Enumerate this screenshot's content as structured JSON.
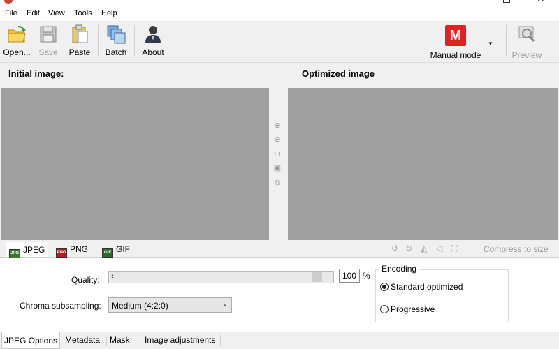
{
  "menu": [
    "File",
    "Edit",
    "View",
    "Tools",
    "Help"
  ],
  "toolbar": {
    "open": "Open...",
    "save": "Save",
    "paste": "Paste",
    "batch": "Batch",
    "about": "About",
    "mode_badge": "M",
    "mode": "Manual mode",
    "preview": "Preview"
  },
  "panels": {
    "initial": "Initial image:",
    "optimized": "Optimized image",
    "zoom_ratio": "1:1"
  },
  "format_tabs": [
    {
      "label": "JPEG",
      "icon": "JPG"
    },
    {
      "label": "PNG",
      "icon": "PNG"
    },
    {
      "label": "GIF",
      "icon": "GIF"
    }
  ],
  "compress_to_size": "Compress to size",
  "jpeg_options": {
    "quality_label": "Quality:",
    "quality_value": "100",
    "quality_unit": "%",
    "chroma_label": "Chroma subsampling:",
    "chroma_value": "Medium (4:2:0)",
    "encoding_title": "Encoding",
    "encoding_options": [
      "Standard optimized",
      "Progressive"
    ],
    "encoding_selected": "Standard optimized"
  },
  "bottom_tabs": [
    "JPEG Options",
    "Metadata",
    "Mask",
    "Image adjustments"
  ],
  "colors": {
    "image_bg": "#a0a0a0",
    "mode_badge": "#e32020"
  }
}
